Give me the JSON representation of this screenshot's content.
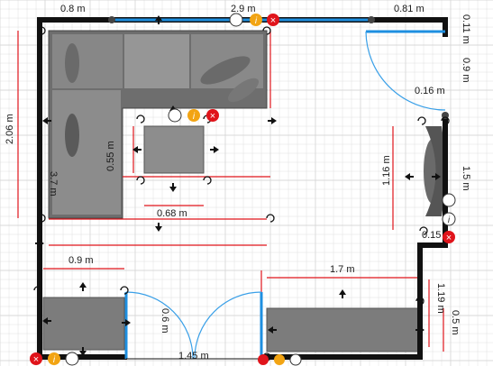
{
  "colors": {
    "wall": "#111111",
    "window": "#1e8fe0",
    "dimension_line": "#e0141b",
    "door_arc": "#3aa0e8",
    "grid": "#d8d8d8",
    "furniture": "#7a7a7a",
    "delete_button": "#e0141b",
    "info_button": "#f2a413"
  },
  "dimensions": {
    "top_left_wall": "0.8 m",
    "top_window": "2.9 m",
    "top_right_wall": "0.81 m",
    "right_top_small": "0.11 m",
    "right_upper": "0.9 m",
    "door_right_width": "0.16 m",
    "sofa_height": "2.06 m",
    "table_height": "0.55 m",
    "sofa_depth": "3.7 m",
    "table_width": "0.68 m",
    "armchair_height": "1.16 m",
    "right_middle": "1.5 m",
    "right_notch": "0.15",
    "left_cabinet_width": "0.9 m",
    "right_cabinet_width": "1.7 m",
    "right_lower": "1.19 m",
    "door_leaf": "0.6 m",
    "cabinet_depth": "0.5 m",
    "bottom_door_opening": "1.45 m"
  },
  "icons": {
    "rotate": "rotate-arrow-icon",
    "move": "move-arrow-icon",
    "pattern": "crosshatch-pattern-icon",
    "info": "info-icon",
    "delete": "delete-x-icon"
  },
  "glyphs": {
    "info": "i",
    "delete": "×"
  }
}
